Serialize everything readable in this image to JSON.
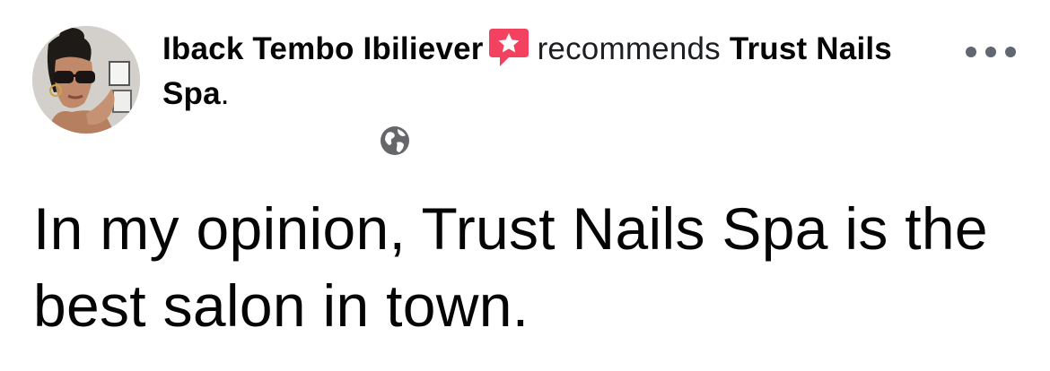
{
  "post": {
    "author_name": "Iback Tembo Ibiliever",
    "verb": "recommends",
    "page_name": "Trust Nails Spa",
    "period": ".",
    "text": "In my opinion, Trust Nails Spa is the best salon in town."
  },
  "icons": {
    "badge": "recommendation-star-badge-icon",
    "privacy": "globe-icon",
    "more": "more-options-icon"
  },
  "colors": {
    "badge": "#f3425f",
    "text": "#050505",
    "secondary": "#606770"
  }
}
